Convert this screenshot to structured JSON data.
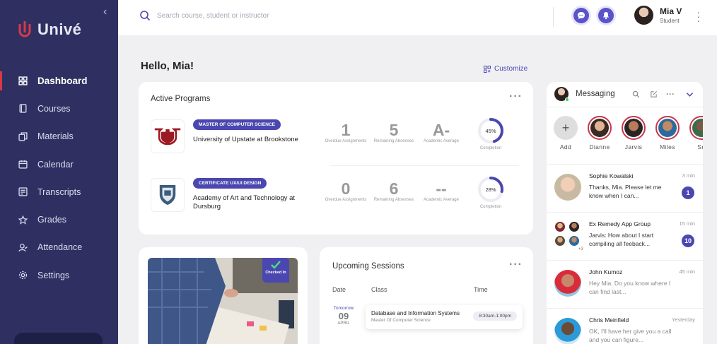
{
  "sidebar": {
    "logo": "Univé",
    "items": [
      {
        "label": "Dashboard",
        "icon": "grid-icon",
        "active": true
      },
      {
        "label": "Courses",
        "icon": "book-icon"
      },
      {
        "label": "Materials",
        "icon": "materials-icon"
      },
      {
        "label": "Calendar",
        "icon": "calendar-icon"
      },
      {
        "label": "Transcripts",
        "icon": "transcripts-icon"
      },
      {
        "label": "Grades",
        "icon": "star-icon"
      },
      {
        "label": "Attendance",
        "icon": "attendance-icon"
      },
      {
        "label": "Settings",
        "icon": "gear-icon"
      }
    ]
  },
  "topbar": {
    "search_placeholder": "Search course, student or instructor",
    "user": {
      "name": "Mia V",
      "role": "Student"
    }
  },
  "main": {
    "greeting": "Hello, Mia!",
    "customize": "Customize"
  },
  "programs": {
    "title": "Active Programs",
    "items": [
      {
        "badge": "Master of Computer Science",
        "name": "University of Upstate at Brookstone",
        "overdue": "1",
        "overdue_label": "Overdue Assignments",
        "absences": "5",
        "absences_label": "Remaining Absenses",
        "average": "A-",
        "average_label": "Academic Average",
        "completion": 45,
        "completion_text": "45%",
        "completion_label": "Completion"
      },
      {
        "badge": "Certificate UX/UI Design",
        "name": "Academy of Art and Technology at Dursburg",
        "overdue": "0",
        "overdue_label": "Overdue Assignments",
        "absences": "6",
        "absences_label": "Remaining Absenses",
        "average": "--",
        "average_label": "Academic Average",
        "completion": 28,
        "completion_text": "28%",
        "completion_label": "Completion"
      }
    ]
  },
  "photo_card": {
    "tag": "Checked In"
  },
  "sessions": {
    "title": "Upcoming Sessions",
    "col_date": "Date",
    "col_class": "Class",
    "col_time": "Time",
    "items": [
      {
        "day_label": "Tomorrow",
        "day": "09",
        "month": "APRIL",
        "class": "Database and Information Systems",
        "program": "Master Of Computer Science",
        "time": "8:30am-1:00pm"
      }
    ]
  },
  "messaging": {
    "title": "Messaging",
    "stories": [
      {
        "label": "Add"
      },
      {
        "label": "Dianne"
      },
      {
        "label": "Jarvis"
      },
      {
        "label": "Miles"
      },
      {
        "label": "Su"
      }
    ],
    "threads": [
      {
        "name": "Sophie Kowalski",
        "time": "3 min",
        "text": "Thanks, Mia. Please let me know when I can...",
        "unread": "1"
      },
      {
        "name": "Ex Remedy App Group",
        "time": "15 min",
        "text": "Jarvis: How about I start compiling all feeback...",
        "unread": "10",
        "more": "+3"
      },
      {
        "name": "John Kumoz",
        "time": "45 min",
        "text": "Hey Mia. Do you know where I can find last..."
      },
      {
        "name": "Chris Meinfield",
        "time": "Yesterday",
        "text": "OK, I'll have her give you a call and you can figure..."
      }
    ]
  },
  "colors": {
    "sidebar": "#2f3061",
    "accent": "#4b47b0",
    "logo_red": "#d8394a"
  }
}
